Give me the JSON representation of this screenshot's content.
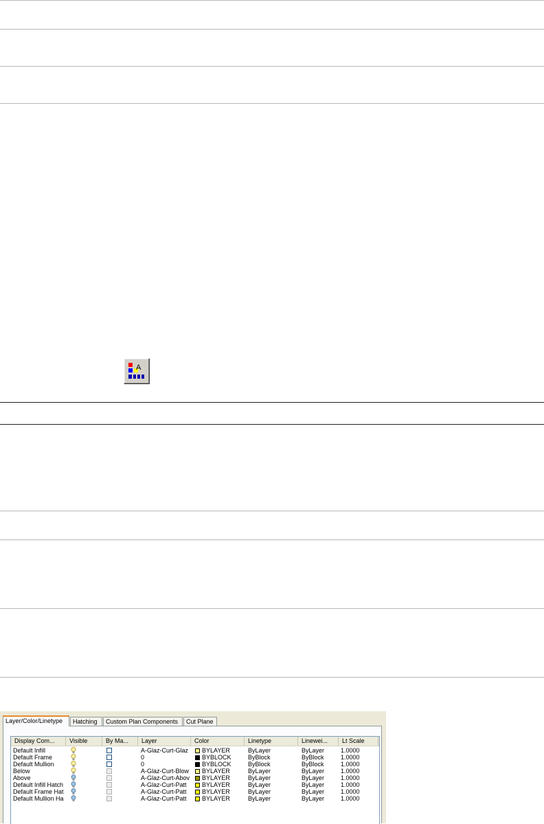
{
  "tabs": [
    {
      "label": "Layer/Color/Linetype",
      "active": true
    },
    {
      "label": "Hatching",
      "active": false
    },
    {
      "label": "Custom Plan Components",
      "active": false
    },
    {
      "label": "Cut Plane",
      "active": false
    }
  ],
  "columns": [
    "Display Com...",
    "Visible",
    "By Ma...",
    "Layer",
    "Color",
    "Linetype",
    "Linewei...",
    "Lt Scale"
  ],
  "rows": [
    {
      "name": "Default Infill",
      "visible": "on",
      "layer": "A-Glaz-Curt-Glaz",
      "color": "BYLAYER",
      "color_hex": "#ffff80",
      "linetype": "ByLayer",
      "lineweight": "ByLayer",
      "ltscale": "1.0000"
    },
    {
      "name": "Default Frame",
      "visible": "on",
      "layer": "0",
      "color": "BYBLOCK",
      "color_hex": "#000000",
      "linetype": "ByBlock",
      "lineweight": "ByBlock",
      "ltscale": "1.0000"
    },
    {
      "name": "Default Mullion",
      "visible": "on",
      "layer": "0",
      "color": "BYBLOCK",
      "color_hex": "#000000",
      "linetype": "ByBlock",
      "lineweight": "ByBlock",
      "ltscale": "1.0000"
    },
    {
      "name": "Below",
      "visible": "on",
      "layer": "A-Glaz-Curt-Blow",
      "color": "BYLAYER",
      "color_hex": "#ffff80",
      "linetype": "ByLayer",
      "lineweight": "ByLayer",
      "ltscale": "1.0000"
    },
    {
      "name": "Above",
      "visible": "off",
      "layer": "A-Glaz-Curt-Abov",
      "color": "BYLAYER",
      "color_hex": "#999900",
      "linetype": "ByLayer",
      "lineweight": "ByLayer",
      "ltscale": "1.0000"
    },
    {
      "name": "Default Infill Hatch",
      "visible": "off",
      "layer": "A-Glaz-Curt-Patt",
      "color": "BYLAYER",
      "color_hex": "#ffff00",
      "linetype": "ByLayer",
      "lineweight": "ByLayer",
      "ltscale": "1.0000"
    },
    {
      "name": "Default Frame Hat",
      "visible": "off",
      "layer": "A-Glaz-Curt-Patt",
      "color": "BYLAYER",
      "color_hex": "#ffff00",
      "linetype": "ByLayer",
      "lineweight": "ByLayer",
      "ltscale": "1.0000"
    },
    {
      "name": "Default Mullion Ha",
      "visible": "off",
      "layer": "A-Glaz-Curt-Patt",
      "color": "BYLAYER",
      "color_hex": "#ffff00",
      "linetype": "ByLayer",
      "lineweight": "ByLayer",
      "ltscale": "1.0000"
    }
  ],
  "icons": {
    "toolbar": "layer-color-properties-icon",
    "bulb_on": "lightbulb-on-icon",
    "bulb_off": "lightbulb-off-icon"
  }
}
